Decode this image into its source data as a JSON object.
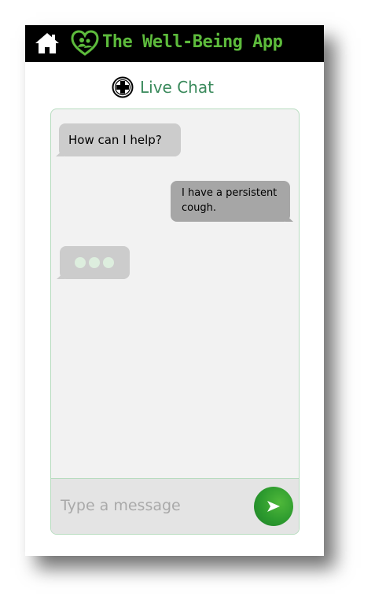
{
  "header": {
    "app_title": "The Well-Being App",
    "home_icon": "home-icon",
    "logo_icon": "heart-people-logo-icon",
    "background_color": "#000000",
    "title_color": "#5dbb3c"
  },
  "chat": {
    "title": "Live Chat",
    "title_icon": "medical-plus-icon",
    "title_color": "#3a8a5c",
    "messages": [
      {
        "sender": "bot",
        "text": "How can I help?"
      },
      {
        "sender": "user",
        "text": "I have a persistent cough."
      }
    ],
    "typing_indicator": true
  },
  "composer": {
    "placeholder": "Type a message",
    "value": "",
    "send_icon": "send-arrow-icon",
    "send_color": "#2c9a2e"
  }
}
